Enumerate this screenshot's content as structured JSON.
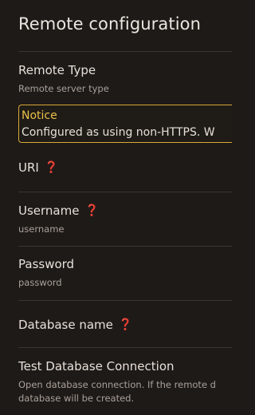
{
  "page": {
    "title": "Remote configuration"
  },
  "settings": {
    "remote_type": {
      "name": "Remote Type",
      "description": "Remote server type"
    },
    "notice": {
      "title": "Notice",
      "text": "Configured as using non-HTTPS. W"
    },
    "uri": {
      "name": "URI",
      "required_marker": "❓"
    },
    "username": {
      "name": "Username",
      "required_marker": "❓",
      "description": "username"
    },
    "password": {
      "name": "Password",
      "description": "password"
    },
    "database_name": {
      "name": "Database name",
      "required_marker": "❓"
    },
    "test_connection": {
      "name": "Test Database Connection",
      "description_line1": "Open database connection. If the remote d",
      "description_line2": "database will be created."
    }
  }
}
